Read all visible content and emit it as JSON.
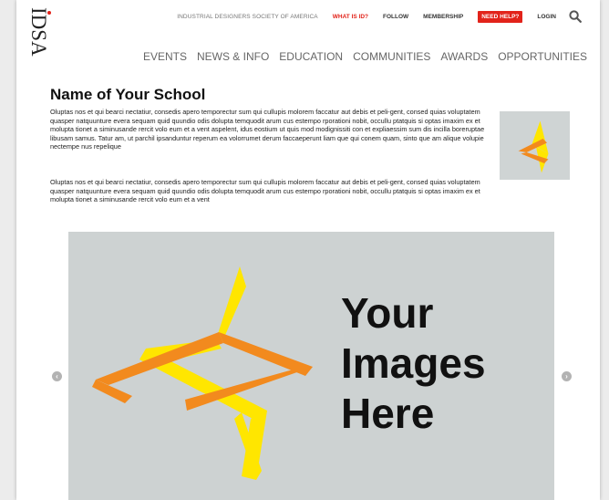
{
  "header": {
    "logo_text": "IDSA",
    "top_nav": {
      "society": "INDUSTRIAL DESIGNERS SOCIETY OF AMERICA",
      "what_is_id": "WHAT IS ID?",
      "follow": "FOLLOW",
      "membership": "MEMBERSHIP",
      "need_help": "NEED HELP?",
      "login": "LOGIN"
    },
    "main_nav": [
      "EVENTS",
      "NEWS & INFO",
      "EDUCATION",
      "COMMUNITIES",
      "AWARDS",
      "OPPORTUNITIES"
    ]
  },
  "content": {
    "title": "Name of Your School",
    "paragraph_1": "Oluptas nos et qui bearci nectatiur, consedis apero temporectur sum qui cullupis molorem faccatur aut debis et peli-gent, consed quias voluptatem quasper natquunture evera sequam quid quundio odis dolupta temquodit arum cus estempo rporationi nobit, occullu ptatquis si optas imaxim ex et molupta tionet a siminusande rercit volo eum et a vent aspelent, idus eostium ut quis mod modignissiti con et expliaessim sum dis incilla boreruptae libusam samus. Tatur am, ut parchil ipsanduntur reperum ea volorrumet derum faccaeperunt liam que qui conem quam, sinto que am alique volupie nectempe nus repelique",
    "paragraph_2": "Oluptas nos et qui bearci nectatiur, consedis apero temporectur sum qui cullupis molorem faccatur aut debis et peli-gent, consed quias voluptatem quasper natquunture evera sequam quid quundio odis dolupta temquodit arum cus estempo rporationi nobit, occullu ptatquis si optas imaxim ex et molupta tionet a siminusande rercit volo eum et a vent"
  },
  "carousel": {
    "hero_lines": [
      "Your",
      "Images",
      "Here"
    ],
    "prev_icon": "chevron-left-icon",
    "next_icon": "chevron-right-icon"
  },
  "colors": {
    "brand_red": "#e2231a",
    "star_yellow": "#ffe600",
    "star_orange": "#f28a1e",
    "placeholder_gray": "#cdd2d2"
  }
}
